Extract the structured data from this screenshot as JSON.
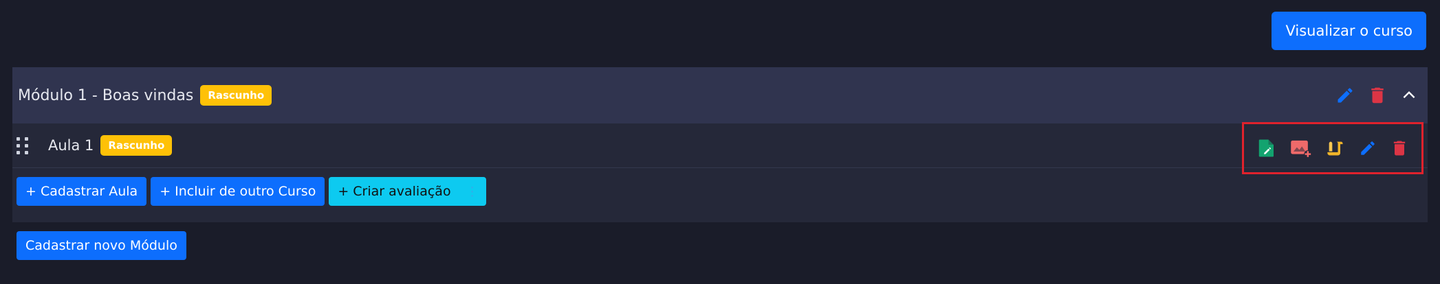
{
  "header": {
    "view_course_label": "Visualizar o curso"
  },
  "module": {
    "title": "Módulo 1 - Boas vindas",
    "status_badge": "Rascunho",
    "lessons": [
      {
        "title": "Aula 1",
        "status_badge": "Rascunho"
      }
    ],
    "buttons": {
      "add_lesson": "+ Cadastrar Aula",
      "include_from_course": "+ Incluir de outro Curso",
      "create_assessment": "+ Criar avaliação",
      "create_assessment_menu": "⋮"
    }
  },
  "footer": {
    "new_module_label": "Cadastrar novo Módulo"
  },
  "colors": {
    "primary": "#0d6efd",
    "cyan": "#0dcaf0",
    "warning": "#ffc107",
    "danger": "#dc3545",
    "success": "#13a36f",
    "highlight_border": "#e0222c"
  },
  "icons": {
    "lesson_actions": [
      "edit-document-icon",
      "add-image-icon",
      "scroll-icon",
      "pencil-icon",
      "trash-icon"
    ],
    "module_actions": [
      "pencil-icon",
      "trash-icon",
      "chevron-up-icon"
    ]
  }
}
